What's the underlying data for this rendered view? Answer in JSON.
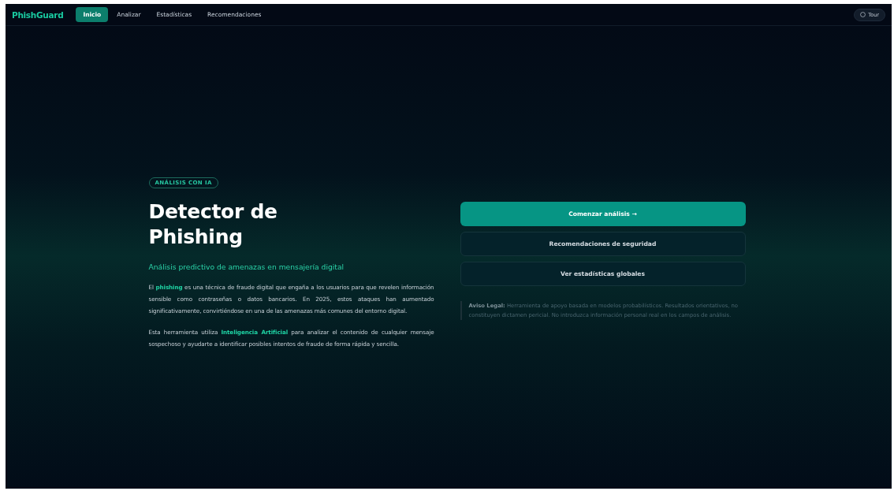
{
  "nav": {
    "brand": "PhishGuard",
    "tabs": [
      {
        "label": "Inicio",
        "selected": true
      },
      {
        "label": "Analizar",
        "selected": false
      },
      {
        "label": "Estadísticas",
        "selected": false
      },
      {
        "label": "Recomendaciones",
        "selected": false
      }
    ],
    "tour": "Tour"
  },
  "hero": {
    "badge": "ANÁLISIS CON IA",
    "title": "Detector de Phishing",
    "subtitle": "Análisis predictivo de amenazas en mensajería digital",
    "paragraphs": [
      "El **phishing** es una técnica de fraude digital que engaña a los usuarios para que revelen información sensible como contraseñas o datos bancarios. En 2025, estos ataques han aumentado significativamente, convirtiéndose en una de las amenazas más comunes del entorno digital.",
      "Esta herramienta utiliza **Inteligencia Artificial** para analizar el contenido de cualquier mensaje sospechoso y ayudarte a identificar posibles intentos de fraude de forma rápida y sencilla."
    ]
  },
  "actions": [
    {
      "label": "Comenzar análisis →",
      "kind": "primary"
    },
    {
      "label": "Recomendaciones de seguridad",
      "kind": "outline"
    },
    {
      "label": "Ver estadísticas globales",
      "kind": "outline"
    }
  ],
  "disclaimer": "**Aviso Legal:** Herramienta de apoyo basada en modelos probabilísticos. Resultados orientativos, no constituyen dictamen pericial. No introduzca información personal real en los campos de análisis."
}
